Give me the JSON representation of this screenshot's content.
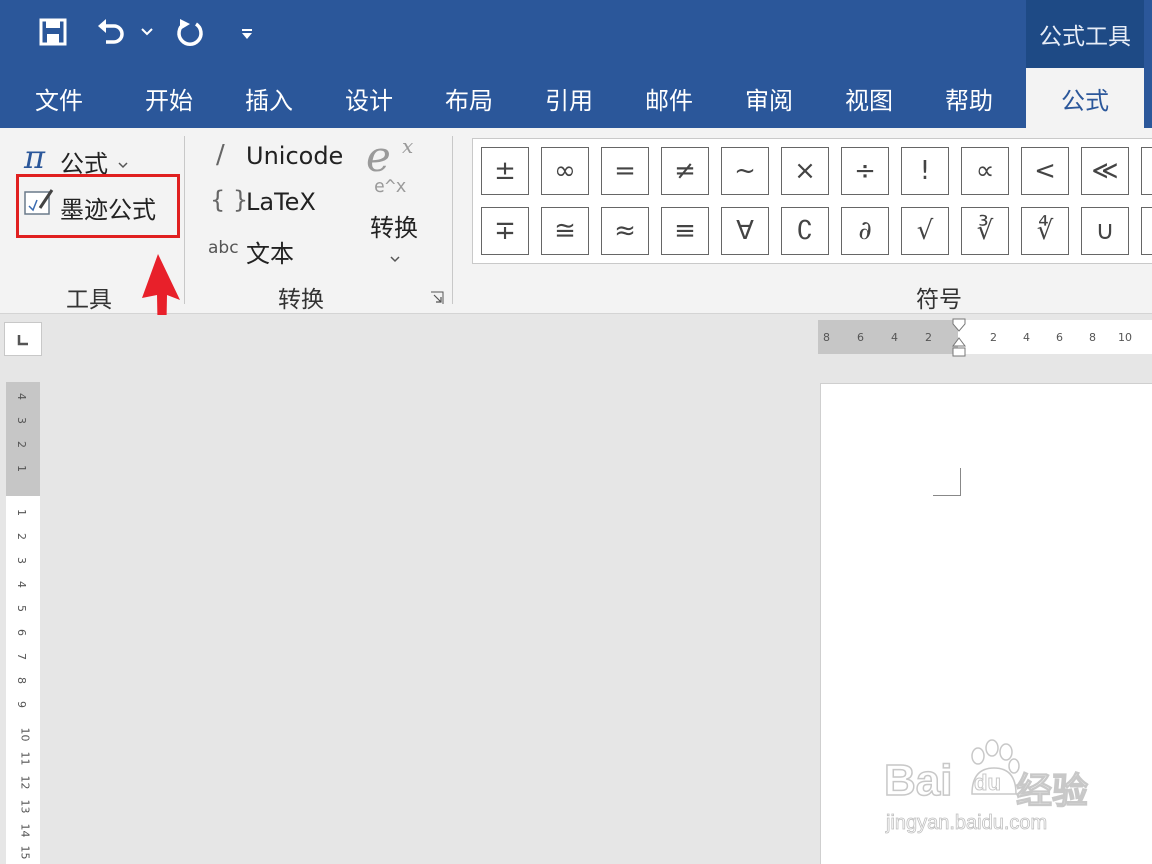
{
  "quick_access": {
    "icons": [
      "save-icon",
      "undo-icon",
      "undo-dropdown-icon",
      "redo-icon",
      "customize-dropdown-icon"
    ]
  },
  "context_tab_label": "公式工具",
  "tabs": [
    {
      "label": "文件"
    },
    {
      "label": "开始"
    },
    {
      "label": "插入"
    },
    {
      "label": "设计"
    },
    {
      "label": "布局"
    },
    {
      "label": "引用"
    },
    {
      "label": "邮件"
    },
    {
      "label": "审阅"
    },
    {
      "label": "视图"
    },
    {
      "label": "帮助"
    },
    {
      "label": "公式",
      "active": true
    }
  ],
  "ribbon": {
    "tools": {
      "equation_label": "公式",
      "ink_equation_label": "墨迹公式",
      "group_label": "工具"
    },
    "conversions": {
      "unicode_label": "Unicode",
      "latex_label": "LaTeX",
      "abc_text": "abc",
      "text_label": "文本",
      "convert_label": "转换",
      "group_label": "转换",
      "convert_icon_top": "e",
      "convert_icon_sup": "x",
      "convert_icon_bottom": "e^x"
    },
    "symbols": {
      "group_label": "符号",
      "row1": [
        "±",
        "∞",
        "=",
        "≠",
        "~",
        "×",
        "÷",
        "!",
        "∝",
        "<",
        "≪"
      ],
      "row2": [
        "∓",
        "≅",
        "≈",
        "≡",
        "∀",
        "∁",
        "∂",
        "√",
        "∛",
        "∜",
        "∪"
      ]
    }
  },
  "ruler": {
    "horizontal": [
      "8",
      "6",
      "4",
      "2",
      "2",
      "4",
      "6",
      "8",
      "10"
    ],
    "vertical": [
      "4",
      "3",
      "2",
      "1",
      "1",
      "2",
      "3",
      "4",
      "5",
      "6",
      "7",
      "8",
      "9",
      "10",
      "11",
      "12",
      "13",
      "14",
      "15"
    ]
  },
  "watermark": {
    "brand_a": "Bai",
    "brand_b": "du",
    "brand_c": "经验",
    "url": "jingyan.baidu.com"
  },
  "colors": {
    "accent": "#2b579a",
    "highlight": "#e02020",
    "arrow": "#e8202a"
  }
}
